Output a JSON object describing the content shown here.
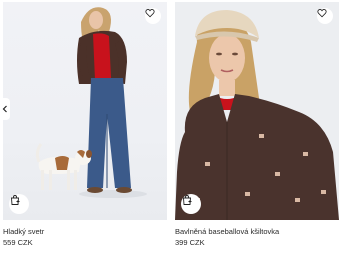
{
  "products": [
    {
      "title": "Hladký svetr",
      "price": "559 CZK",
      "image": "model-red-sweater-jeans-with-dog"
    },
    {
      "title": "Bavlněná baseballová kšiltovka",
      "price": "399 CZK",
      "image": "model-beige-cap-brown-shirt"
    }
  ],
  "icons": {
    "wishlist": "heart-icon",
    "add_to_bag": "shopping-bag-icon",
    "carousel_prev": "chevron-left-icon"
  },
  "colors": {
    "text": "#2b2b2b",
    "background": "#ffffff"
  }
}
